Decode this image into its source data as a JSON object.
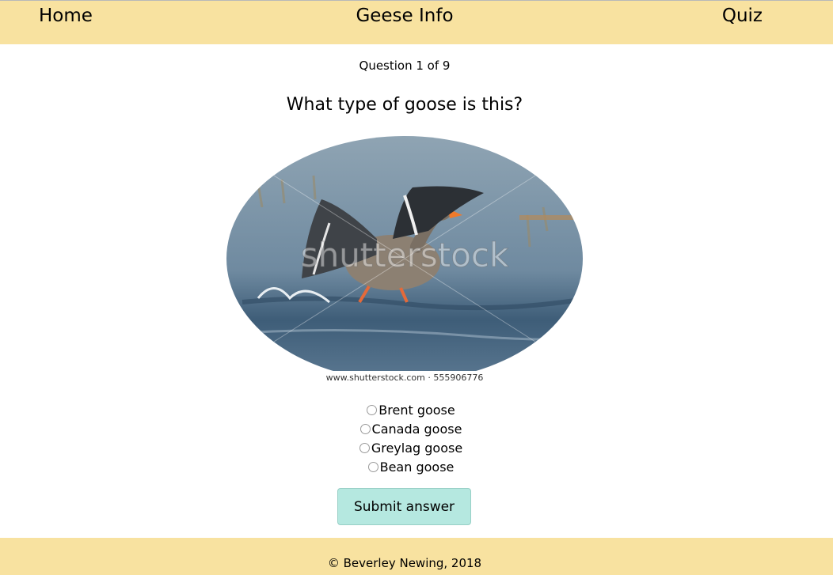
{
  "nav": {
    "home": "Home",
    "info": "Geese Info",
    "quiz": "Quiz"
  },
  "quiz": {
    "counter": "Question 1 of 9",
    "question": "What type of goose is this?",
    "image": {
      "watermark": "shutterstock",
      "caption": "www.shutterstock.com · 555906776"
    },
    "options": [
      {
        "label": "Brent goose",
        "selected": false
      },
      {
        "label": "Canada goose",
        "selected": false
      },
      {
        "label": "Greylag goose",
        "selected": false
      },
      {
        "label": "Bean goose",
        "selected": false
      }
    ],
    "submit_label": "Submit answer"
  },
  "footer": {
    "copyright": "© Beverley Newing, 2018"
  },
  "colors": {
    "header_footer_bg": "#f8e2a0",
    "submit_bg": "#b5e8e0"
  }
}
